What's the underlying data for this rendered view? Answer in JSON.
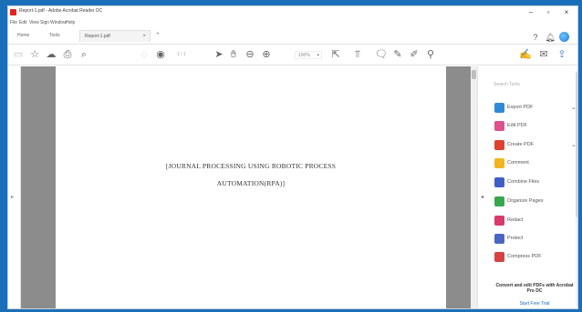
{
  "window": {
    "title": "Report-1.pdf - Adobe Acrobat Reader DC",
    "controls": {
      "minimize": "–",
      "maximize": "▫",
      "close": "×"
    }
  },
  "menu": [
    "File",
    "Edit",
    "View",
    "Sign",
    "Window",
    "Help"
  ],
  "tabs": {
    "home": "Home",
    "tools": "Tools",
    "document": "Report-1.pdf",
    "close": "×",
    "add": "+"
  },
  "toolbar": {
    "page_count": "1 / 1",
    "zoom": "100%"
  },
  "document": {
    "line1": "[JOURNAL PROCESSING USING ROBOTIC PROCESS",
    "line2": "AUTOMATION(RPA)]"
  },
  "right_panel": {
    "search_placeholder": "Search Tools",
    "tools": [
      {
        "label": "Export PDF",
        "color": "#2f8ad8",
        "has_caret": true
      },
      {
        "label": "Edit PDF",
        "color": "#e04e8c",
        "has_caret": false
      },
      {
        "label": "Create PDF",
        "color": "#e0412f",
        "has_caret": true
      },
      {
        "label": "Comment",
        "color": "#f2b51e",
        "has_caret": false
      },
      {
        "label": "Combine Files",
        "color": "#3f5fc8",
        "has_caret": false
      },
      {
        "label": "Organize Pages",
        "color": "#35a84c",
        "has_caret": false
      },
      {
        "label": "Redact",
        "color": "#d83a6e",
        "has_caret": false
      },
      {
        "label": "Protect",
        "color": "#4a66c4",
        "has_caret": false
      },
      {
        "label": "Compress PDF",
        "color": "#d94141",
        "has_caret": false
      }
    ],
    "promo_text": "Convert and edit PDFs with Acrobat Pro DC",
    "promo_link": "Start Free Trial"
  },
  "colors": {
    "desktop": "#1b6fb8",
    "doc_background": "#8c8c8c",
    "acrobat_red": "#e3241b"
  }
}
